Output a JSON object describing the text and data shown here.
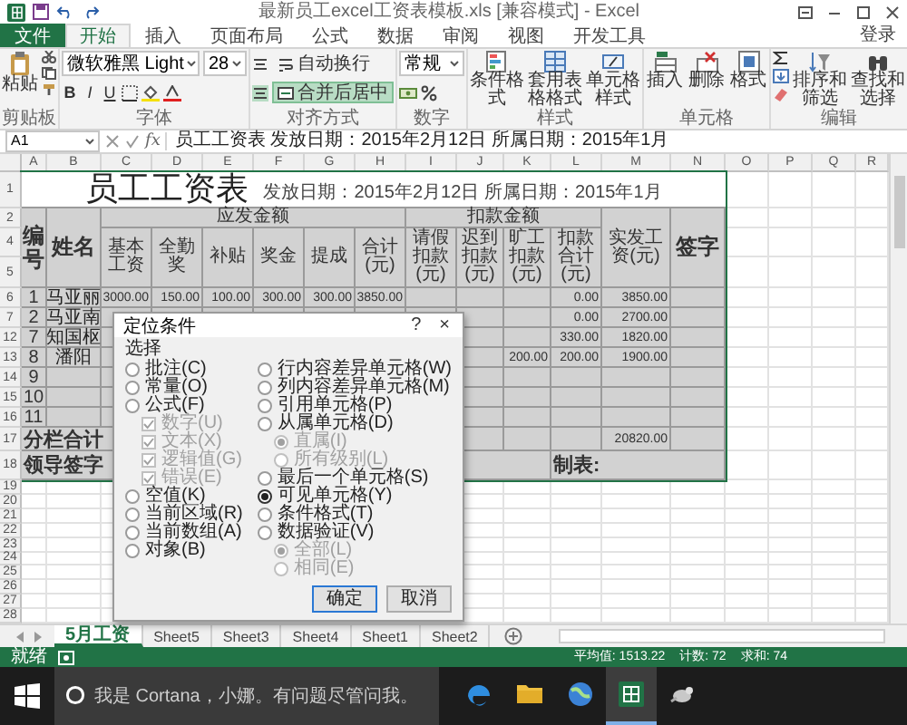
{
  "window": {
    "title": "最新员工excel工资表模板.xls [兼容模式] - Excel"
  },
  "menu_tabs": [
    {
      "label": "文件",
      "kind": "file",
      "selected": false
    },
    {
      "label": "开始",
      "kind": "tab",
      "selected": true
    },
    {
      "label": "插入",
      "kind": "tab",
      "selected": false
    },
    {
      "label": "页面布局",
      "kind": "tab",
      "selected": false
    },
    {
      "label": "公式",
      "kind": "tab",
      "selected": false
    },
    {
      "label": "数据",
      "kind": "tab",
      "selected": false
    },
    {
      "label": "审阅",
      "kind": "tab",
      "selected": false
    },
    {
      "label": "视图",
      "kind": "tab",
      "selected": false
    },
    {
      "label": "开发工具",
      "kind": "tab",
      "selected": false
    }
  ],
  "account": "登录",
  "ribbon": [
    {
      "kind": "clipboard",
      "label": "剪贴板",
      "paste": "粘贴"
    },
    {
      "kind": "font",
      "label": "字体",
      "font": "微软雅黑 Light",
      "size": "28",
      "styles": [
        "B",
        "I",
        "U"
      ]
    },
    {
      "kind": "alignment",
      "label": "对齐方式",
      "buttons": [
        {
          "label": "自动换行",
          "selected": false
        },
        {
          "label": "合并后居中",
          "selected": true
        }
      ]
    },
    {
      "kind": "number",
      "label": "数字",
      "format": "常规"
    },
    {
      "kind": "styles",
      "label": "样式",
      "buttons": [
        "条件格式",
        "套用表格格式",
        "单元格样式"
      ]
    },
    {
      "kind": "cells",
      "label": "单元格",
      "buttons": [
        "插入",
        "删除",
        "格式"
      ]
    },
    {
      "kind": "editing",
      "label": "编辑",
      "buttons": [
        "排序和筛选",
        "查找和选择"
      ]
    }
  ],
  "formula_bar": {
    "name_box": "A1",
    "fx": "fx",
    "value": "员工工资表  发放日期：2015年2月12日  所属日期：2015年1月"
  },
  "sheet": {
    "columns": [
      "A",
      "B",
      "C",
      "D",
      "E",
      "F",
      "G",
      "H",
      "I",
      "J",
      "K",
      "L",
      "M",
      "N",
      "O",
      "P",
      "Q",
      "R"
    ],
    "title": {
      "row": "1",
      "text": "员工工资表",
      "subtitle": "发放日期：2015年2月12日 所属日期：2015年1月"
    },
    "header": {
      "rows": [
        "2",
        "4",
        "5"
      ],
      "number": "编号",
      "name": "姓名",
      "groups": [
        "应发金额",
        "扣款金额"
      ],
      "columns": [
        "基本工资",
        "全勤奖",
        "补贴",
        "奖金",
        "提成",
        "合计(元)",
        "请假扣款(元)",
        "迟到扣款(元)",
        "旷工扣款(元)",
        "扣款合计(元)"
      ],
      "net": "实发工资(元)",
      "sign": "签字"
    },
    "rows": [
      {
        "row": "6",
        "cells": [
          "1",
          "马亚丽",
          "3000.00",
          "150.00",
          "100.00",
          "300.00",
          "300.00",
          "3850.00",
          null,
          null,
          null,
          "0.00",
          "3850.00",
          null
        ]
      },
      {
        "row": "7",
        "cells": [
          "2",
          "马亚南",
          null,
          null,
          null,
          null,
          null,
          null,
          null,
          null,
          null,
          "0.00",
          "2700.00",
          null
        ]
      },
      {
        "row": "12",
        "cells": [
          "7",
          "知国枢",
          null,
          null,
          null,
          null,
          null,
          null,
          null,
          null,
          null,
          "330.00",
          "1820.00",
          null
        ]
      },
      {
        "row": "13",
        "cells": [
          "8",
          "潘阳",
          null,
          null,
          null,
          null,
          null,
          null,
          null,
          null,
          "200.00",
          "200.00",
          "1900.00",
          null
        ]
      },
      {
        "row": "14",
        "cells": [
          "9",
          null,
          null,
          null,
          null,
          null,
          null,
          null,
          null,
          null,
          null,
          null,
          null,
          null
        ]
      },
      {
        "row": "15",
        "cells": [
          "10",
          null,
          null,
          null,
          null,
          null,
          null,
          null,
          null,
          null,
          null,
          null,
          null,
          null
        ]
      },
      {
        "row": "16",
        "cells": [
          "11",
          null,
          null,
          null,
          null,
          null,
          null,
          null,
          null,
          null,
          null,
          null,
          null,
          null
        ]
      }
    ],
    "total": {
      "row": "17",
      "label": "分栏合计",
      "net": "20820.00"
    },
    "signature": {
      "row": "18",
      "label": "领导签字",
      "maker": "制表:"
    },
    "empty_rows": [
      "19",
      "20",
      "21",
      "22",
      "23",
      "24",
      "25",
      "26",
      "27",
      "28"
    ]
  },
  "dialog": {
    "title": "定位条件",
    "help": "?",
    "close": "×",
    "section": "选择",
    "columns": [
      {
        "items": [
          {
            "label": "批注(C)",
            "kind": "radio",
            "selected": false,
            "disabled": false
          },
          {
            "label": "常量(O)",
            "kind": "radio",
            "selected": false,
            "disabled": false
          },
          {
            "label": "公式(F)",
            "kind": "radio",
            "selected": false,
            "disabled": false,
            "children": [
              {
                "label": "数字(U)",
                "kind": "checkbox",
                "checked": true,
                "disabled": true
              },
              {
                "label": "文本(X)",
                "kind": "checkbox",
                "checked": true,
                "disabled": true
              },
              {
                "label": "逻辑值(G)",
                "kind": "checkbox",
                "checked": true,
                "disabled": true
              },
              {
                "label": "错误(E)",
                "kind": "checkbox",
                "checked": true,
                "disabled": true
              }
            ]
          },
          {
            "label": "空值(K)",
            "kind": "radio",
            "selected": false,
            "disabled": false
          },
          {
            "label": "当前区域(R)",
            "kind": "radio",
            "selected": false,
            "disabled": false
          },
          {
            "label": "当前数组(A)",
            "kind": "radio",
            "selected": false,
            "disabled": false
          },
          {
            "label": "对象(B)",
            "kind": "radio",
            "selected": false,
            "disabled": false
          }
        ]
      },
      {
        "items": [
          {
            "label": "行内容差异单元格(W)",
            "kind": "radio",
            "selected": false,
            "disabled": false
          },
          {
            "label": "列内容差异单元格(M)",
            "kind": "radio",
            "selected": false,
            "disabled": false
          },
          {
            "label": "引用单元格(P)",
            "kind": "radio",
            "selected": false,
            "disabled": false
          },
          {
            "label": "从属单元格(D)",
            "kind": "radio",
            "selected": false,
            "disabled": false,
            "children": [
              {
                "label": "直属(I)",
                "kind": "radio",
                "selected": true,
                "disabled": true
              },
              {
                "label": "所有级别(L)",
                "kind": "radio",
                "selected": false,
                "disabled": true
              }
            ]
          },
          {
            "label": "最后一个单元格(S)",
            "kind": "radio",
            "selected": false,
            "disabled": false
          },
          {
            "label": "可见单元格(Y)",
            "kind": "radio",
            "selected": true,
            "disabled": false
          },
          {
            "label": "条件格式(T)",
            "kind": "radio",
            "selected": false,
            "disabled": false
          },
          {
            "label": "数据验证(V)",
            "kind": "radio",
            "selected": false,
            "disabled": false,
            "children": [
              {
                "label": "全部(L)",
                "kind": "radio",
                "selected": true,
                "disabled": true
              },
              {
                "label": "相同(E)",
                "kind": "radio",
                "selected": false,
                "disabled": true
              }
            ]
          }
        ]
      }
    ],
    "buttons": [
      {
        "label": "确定",
        "kind": "default"
      },
      {
        "label": "取消",
        "kind": "normal"
      }
    ]
  },
  "sheet_tabs": [
    {
      "label": "5月工资",
      "selected": true
    },
    {
      "label": "Sheet5",
      "selected": false
    },
    {
      "label": "Sheet3",
      "selected": false
    },
    {
      "label": "Sheet4",
      "selected": false
    },
    {
      "label": "Sheet1",
      "selected": false
    },
    {
      "label": "Sheet2",
      "selected": false
    }
  ],
  "status_bar": {
    "mode": "就绪",
    "stats": [
      "平均值: 1513.22",
      "计数: 72",
      "求和: 74"
    ]
  },
  "taskbar": {
    "search": {
      "placeholder": "我是 Cortana，小娜。有问题尽管问我。"
    },
    "apps": [
      {
        "kind": "edge",
        "selected": false
      },
      {
        "kind": "folder",
        "selected": false
      },
      {
        "kind": "globe",
        "selected": false
      },
      {
        "kind": "excel",
        "selected": true
      },
      {
        "kind": "app",
        "selected": false
      }
    ]
  }
}
